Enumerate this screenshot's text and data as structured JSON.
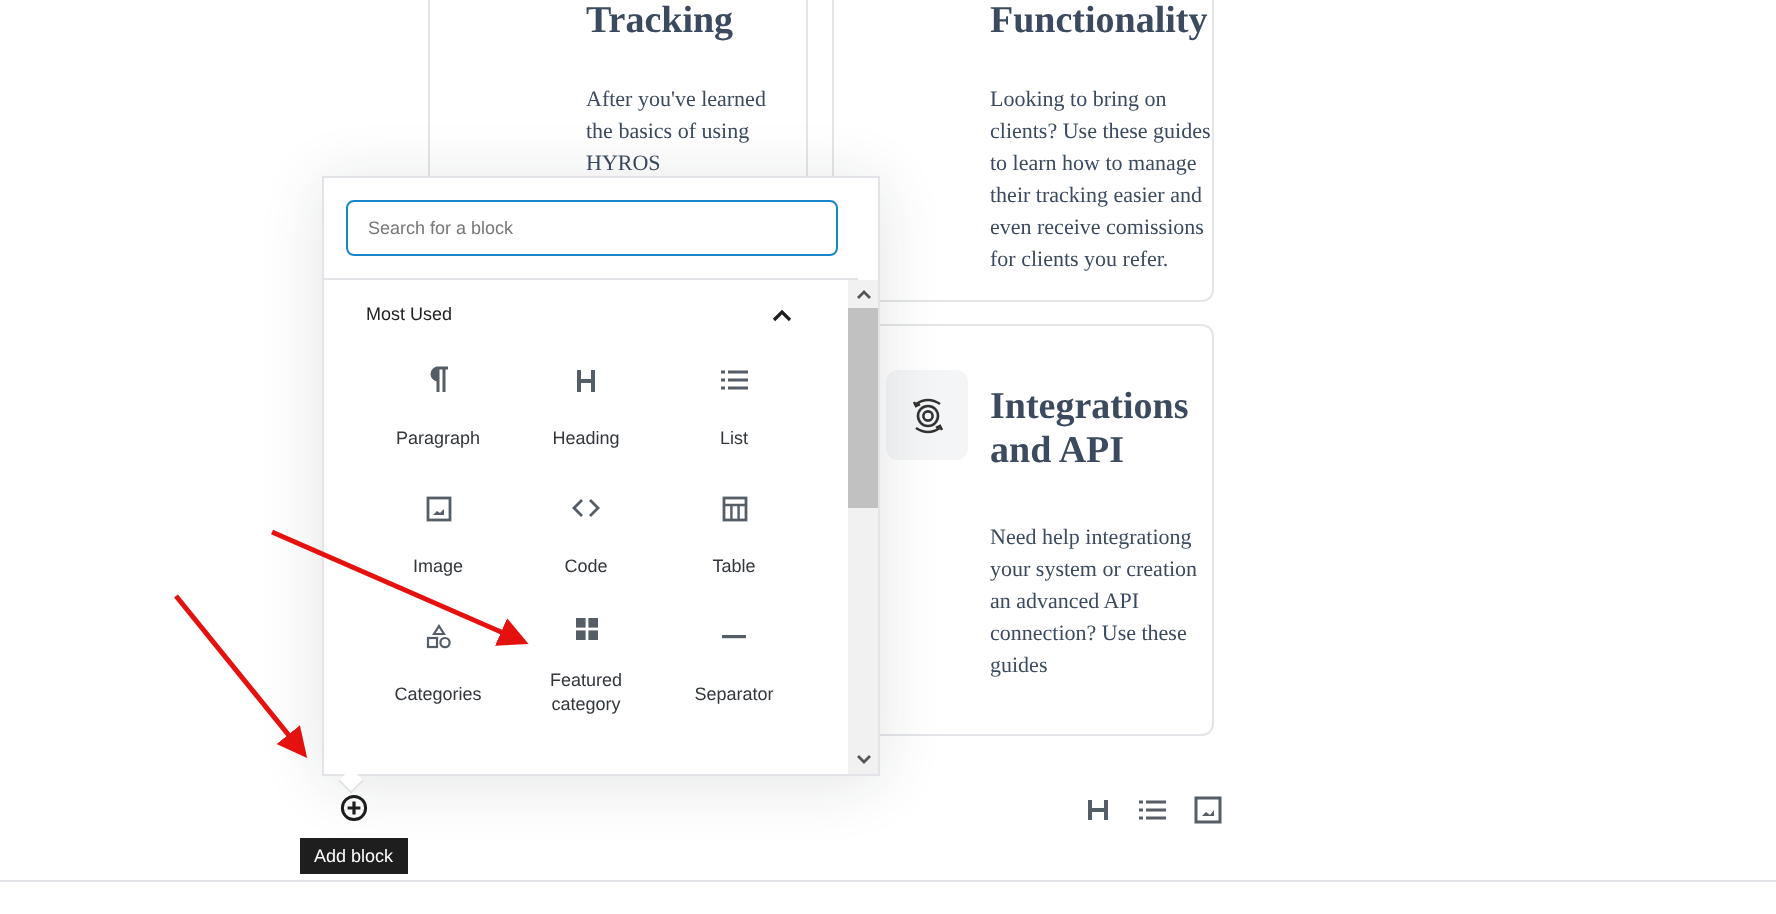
{
  "cards": [
    {
      "title": "Tracking",
      "text": "After you've learned the basics of using HYROS",
      "has_icon": false
    },
    {
      "title": "Functionality",
      "text": "Looking to bring on clients? Use these guides to learn how to manage their tracking easier and even receive comissions for clients you refer.",
      "has_icon": false
    },
    {
      "title": "Integrations and API",
      "text": "Need help integrationg your system or creation an advanced API connection? Use these guides",
      "has_icon": true
    }
  ],
  "inserter": {
    "search": {
      "placeholder": "Search for a block"
    },
    "section": {
      "title": "Most Used",
      "expanded": true
    },
    "blocks": [
      {
        "label": "Paragraph"
      },
      {
        "label": "Heading"
      },
      {
        "label": "List"
      },
      {
        "label": "Image"
      },
      {
        "label": "Code"
      },
      {
        "label": "Table"
      },
      {
        "label": "Categories"
      },
      {
        "label": "Featured category"
      },
      {
        "label": "Separator"
      }
    ]
  },
  "add_block": {
    "tooltip": "Add block"
  }
}
